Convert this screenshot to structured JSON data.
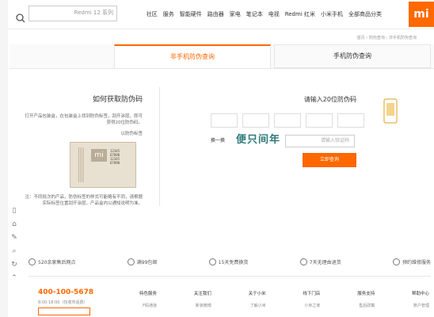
{
  "nav": {
    "search_placeholder": "Redmi 12 系列",
    "links": [
      "全部商品分类",
      "小米手机",
      "Redmi 红米",
      "电视",
      "笔记本",
      "家电",
      "路由器",
      "智能硬件",
      "服务",
      "社区"
    ],
    "logo": "mi"
  },
  "breadcrumb": "首页 › 防伪查询 › 非手机防伪查询",
  "tabs": [
    {
      "label": "手机防伪查询",
      "active": false
    },
    {
      "label": "非手机防伪查询",
      "active": true
    }
  ],
  "left": {
    "title": "如何获取防伪码",
    "p1": "打开产品包装盒，在包装盒上找到防伪标签，刮开涂层，即可获得20位防伪码。",
    "p2": "以防伪标签",
    "label_numbers": [
      "12345",
      "67890",
      "12345",
      "67890"
    ],
    "p3": "注：不同批次的产品，防伪标签的样式可能略有不同，请根据实际标签位置刮开涂层，产品盒内以通知说明为准。"
  },
  "right": {
    "title": "请输入20位防伪码",
    "captcha_placeholder": "请输入验证码",
    "captcha_text": "便只间年",
    "refresh": "换一换",
    "submit": "立即查询"
  },
  "services": [
    {
      "icon": "wrench-icon",
      "label": "预约维修服务"
    },
    {
      "icon": "return-icon",
      "label": "7天无理由退货"
    },
    {
      "icon": "exchange-icon",
      "label": "15天免费换货"
    },
    {
      "icon": "gift-icon",
      "label": "满99包邮"
    },
    {
      "icon": "location-icon",
      "label": "520余家售后网点"
    }
  ],
  "footer": {
    "cols": [
      {
        "title": "帮助中心",
        "sub": "账户管理"
      },
      {
        "title": "服务支持",
        "sub": "售后政策"
      },
      {
        "title": "线下门店",
        "sub": "小米之家"
      },
      {
        "title": "关于小米",
        "sub": "了解小米"
      },
      {
        "title": "关注我们",
        "sub": "新浪微博"
      },
      {
        "title": "特色服务",
        "sub": "F码通道"
      }
    ],
    "hotline": "400-100-5678",
    "hotline_sub": "8:00-18:00（仅收市话费）"
  },
  "sidetools": [
    "▯",
    "⌂",
    "✎",
    "⌕",
    "↻",
    "⌃"
  ],
  "colors": {
    "accent": "#ff6700"
  }
}
